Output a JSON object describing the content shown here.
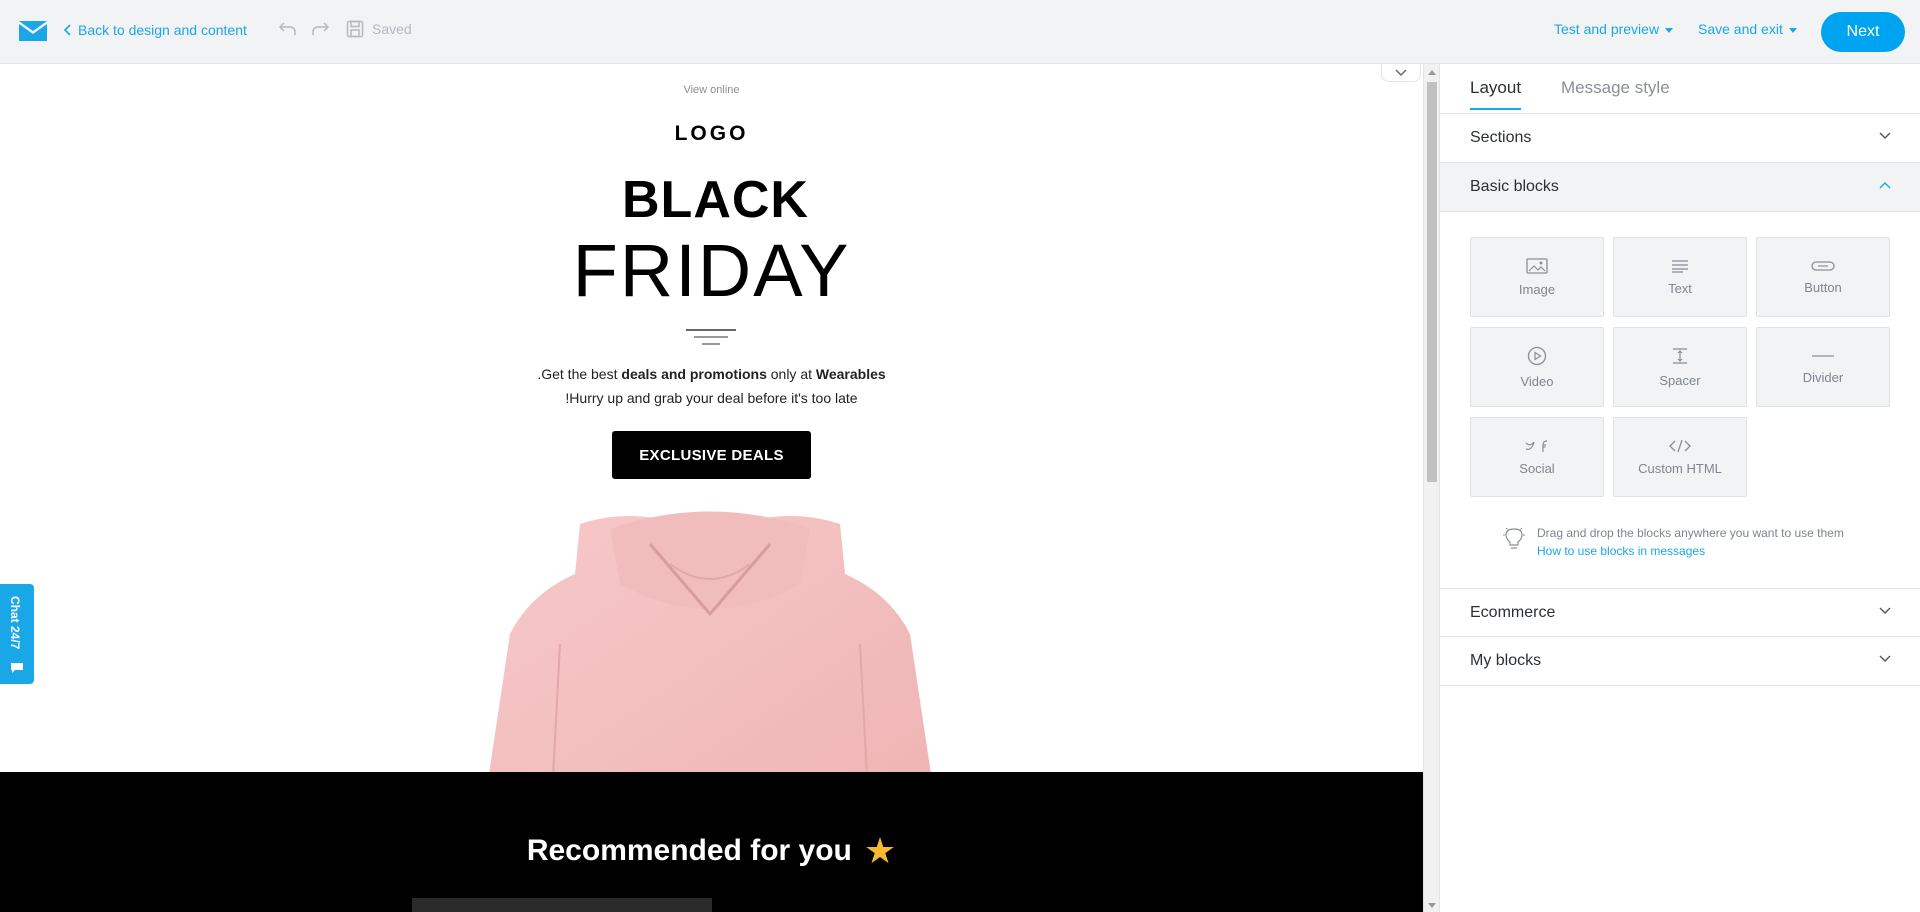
{
  "topbar": {
    "back_label": "Back to design and content",
    "saved_label": "Saved",
    "test_preview_label": "Test and preview",
    "save_exit_label": "Save and exit",
    "next_label": "Next",
    "accent_color": "#1aa7e8"
  },
  "email": {
    "view_online": "View online",
    "logo": "LOGO",
    "headline_1": "BLACK",
    "headline_2": "FRIDAY",
    "text_line1_a": ".Get the best ",
    "text_line1_bold1": "deals and promotions",
    "text_line1_b": " only at ",
    "text_line1_bold2": "Wearables",
    "text_line2": "!Hurry up and grab your deal before it's too late",
    "cta_label": "EXCLUSIVE DEALS",
    "recommended": "Recommended for you",
    "star": "★"
  },
  "chat": {
    "label": "Chat 24/7"
  },
  "panel": {
    "tabs": [
      {
        "label": "Layout",
        "active": true
      },
      {
        "label": "Message style",
        "active": false
      }
    ],
    "sections": [
      {
        "label": "Sections",
        "open": false
      },
      {
        "label": "Basic blocks",
        "open": true
      },
      {
        "label": "Ecommerce",
        "open": false
      },
      {
        "label": "My blocks",
        "open": false
      }
    ],
    "blocks": [
      {
        "label": "Image",
        "icon": "image-icon"
      },
      {
        "label": "Text",
        "icon": "text-icon"
      },
      {
        "label": "Button",
        "icon": "button-icon"
      },
      {
        "label": "Video",
        "icon": "video-icon"
      },
      {
        "label": "Spacer",
        "icon": "spacer-icon"
      },
      {
        "label": "Divider",
        "icon": "divider-icon"
      },
      {
        "label": "Social",
        "icon": "social-icon"
      },
      {
        "label": "Custom HTML",
        "icon": "code-icon"
      }
    ],
    "hint_text": "Drag and drop the blocks anywhere you want to use them",
    "hint_link": "How to use blocks in messages"
  }
}
